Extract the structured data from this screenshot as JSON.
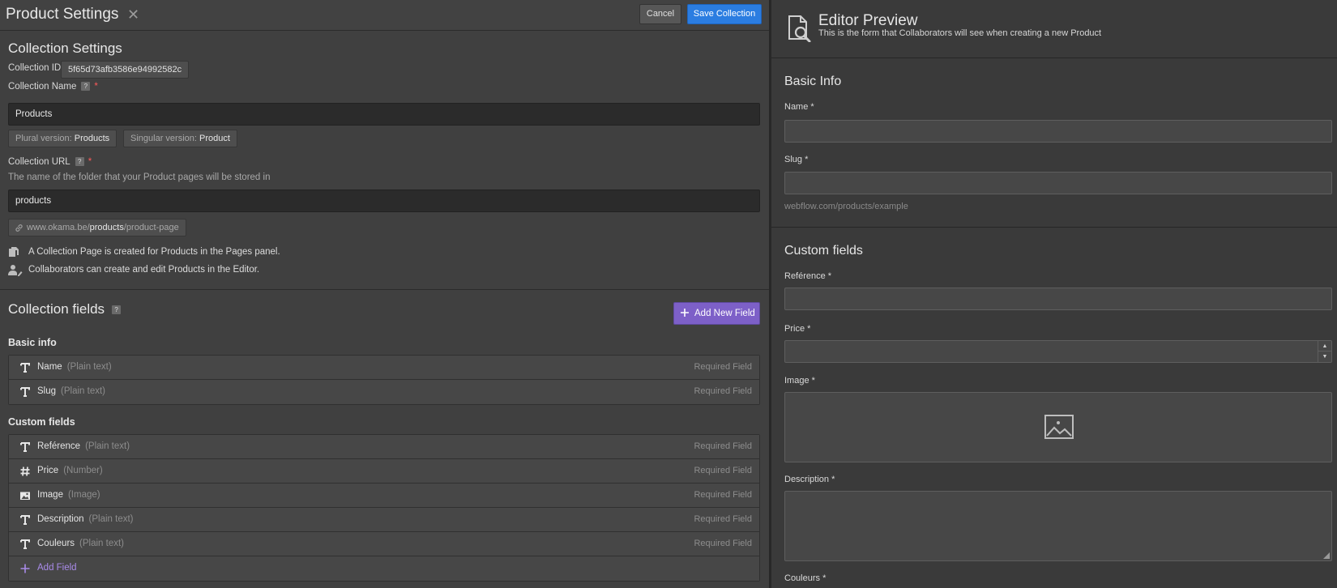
{
  "header": {
    "title": "Product Settings",
    "cancel_label": "Cancel",
    "save_label": "Save Collection"
  },
  "settings": {
    "heading": "Collection Settings",
    "id_label": "Collection ID",
    "id_value": "5f65d73afb3586e94992582c",
    "name_label": "Collection Name",
    "name_value": "Products",
    "plural_prefix": "Plural version: ",
    "plural_value": "Products",
    "singular_prefix": "Singular version: ",
    "singular_value": "Product",
    "url_label": "Collection URL",
    "url_help": "The name of the folder that your Product pages will be stored in",
    "url_value": "products",
    "url_preview_prefix": "www.okama.be/",
    "url_preview_bold": "products",
    "url_preview_suffix": "/product-page",
    "info_pages": "A Collection Page is created for Products in the Pages panel.",
    "info_editor": "Collaborators can create and edit Products in the Editor.",
    "help_glyph": "?",
    "required_mark": "*"
  },
  "fields": {
    "heading": "Collection fields",
    "add_new_label": "Add New Field",
    "basic_title": "Basic info",
    "custom_title": "Custom fields",
    "required_text": "Required Field",
    "add_field_label": "Add Field",
    "basic": [
      {
        "name": "Name",
        "type": "(Plain text)",
        "icon": "text-icon"
      },
      {
        "name": "Slug",
        "type": "(Plain text)",
        "icon": "text-icon"
      }
    ],
    "custom": [
      {
        "name": "Reférence",
        "type": "(Plain text)",
        "icon": "text-icon"
      },
      {
        "name": "Price",
        "type": "(Number)",
        "icon": "number-icon"
      },
      {
        "name": "Image",
        "type": "(Image)",
        "icon": "image-icon"
      },
      {
        "name": "Description",
        "type": "(Plain text)",
        "icon": "text-icon"
      },
      {
        "name": "Couleurs",
        "type": "(Plain text)",
        "icon": "text-icon"
      }
    ]
  },
  "preview": {
    "title": "Editor Preview",
    "subtitle": "This is the form that Collaborators will see when creating a new Product",
    "basic_heading": "Basic Info",
    "name_label": "Name *",
    "slug_label": "Slug *",
    "slug_hint": "webflow.com/products/example",
    "custom_heading": "Custom fields",
    "reference_label": "Reférence *",
    "price_label": "Price *",
    "image_label": "Image *",
    "description_label": "Description *",
    "couleurs_label": "Couleurs *",
    "spin_up": "▲",
    "spin_down": "▼"
  },
  "colors": {
    "accent_blue": "#2b7de1",
    "accent_purple": "#7d60c8",
    "required_red": "#ff5a5a"
  }
}
